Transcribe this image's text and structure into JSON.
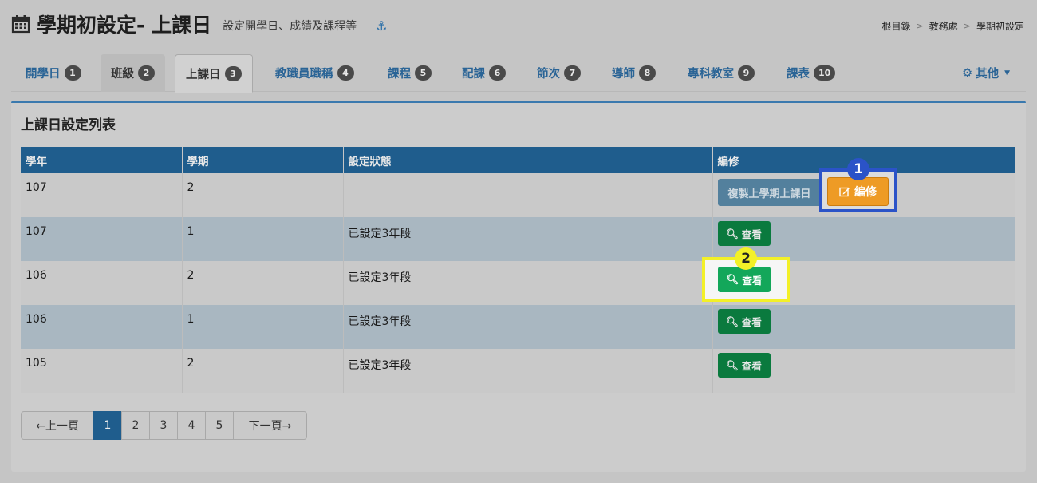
{
  "header": {
    "title": "學期初設定- 上課日",
    "subtitle": "設定開學日、成績及課程等",
    "anchor_icon": "⚓"
  },
  "breadcrumb": [
    "根目錄",
    "教務處",
    "學期初設定"
  ],
  "tabs": [
    {
      "label": "開學日",
      "badge": "1"
    },
    {
      "label": "班級",
      "badge": "2"
    },
    {
      "label": "上課日",
      "badge": "3"
    },
    {
      "label": "教職員職稱",
      "badge": "4"
    },
    {
      "label": "課程",
      "badge": "5"
    },
    {
      "label": "配課",
      "badge": "6"
    },
    {
      "label": "節次",
      "badge": "7"
    },
    {
      "label": "導師",
      "badge": "8"
    },
    {
      "label": "專科教室",
      "badge": "9"
    },
    {
      "label": "課表",
      "badge": "10"
    }
  ],
  "tab_other": {
    "icon": "⚙",
    "label": "其他"
  },
  "panel": {
    "title": "上課日設定列表"
  },
  "table": {
    "headers": [
      "學年",
      "學期",
      "設定狀態",
      "編修"
    ],
    "rows": [
      {
        "year": "107",
        "semester": "2",
        "status": ""
      },
      {
        "year": "107",
        "semester": "1",
        "status": "已設定3年段"
      },
      {
        "year": "106",
        "semester": "2",
        "status": "已設定3年段"
      },
      {
        "year": "106",
        "semester": "1",
        "status": "已設定3年段"
      },
      {
        "year": "105",
        "semester": "2",
        "status": "已設定3年段"
      }
    ]
  },
  "buttons": {
    "copy_prev": "複製上學期上課日",
    "edit": "編修",
    "view": "查看"
  },
  "markers": {
    "one": "1",
    "two": "2"
  },
  "colors": {
    "highlight_blue": "#2b53c8",
    "highlight_yellow": "#f3f028",
    "header_blue": "#1f5d8d",
    "edit_orange": "#ee9b25",
    "view_green": "#0a7a3e"
  },
  "pagination": {
    "prev": "←上一頁",
    "pages": [
      "1",
      "2",
      "3",
      "4",
      "5"
    ],
    "next": "下一頁→",
    "current": "1"
  }
}
